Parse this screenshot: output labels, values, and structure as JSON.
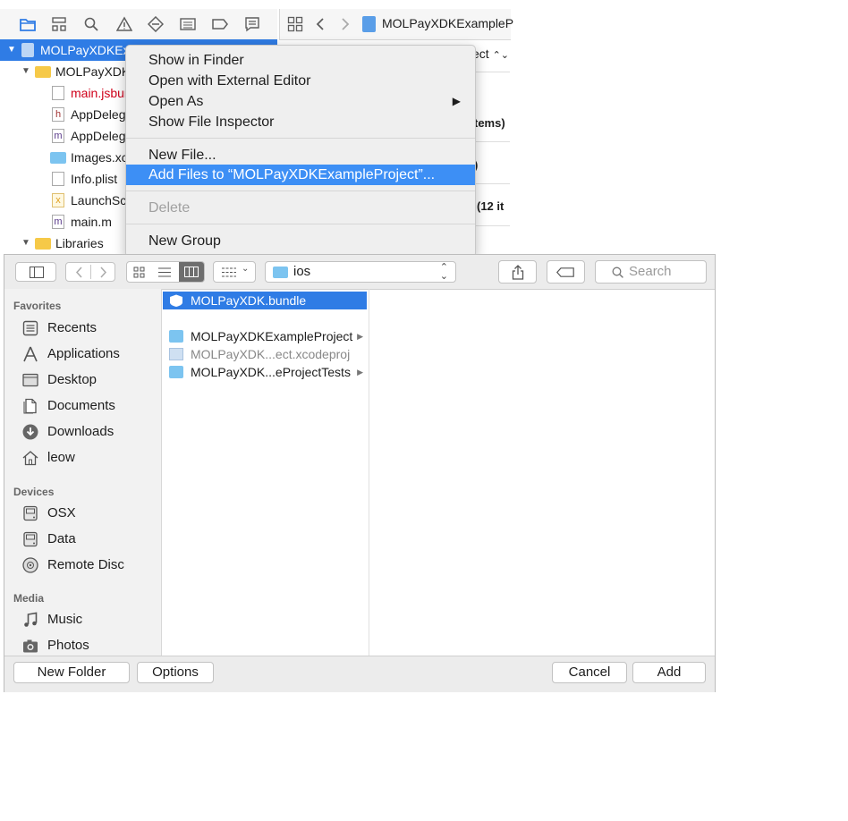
{
  "xcode": {
    "navigator": {
      "project_root": "MOLPayXDKEx",
      "group": "MOLPayXDK",
      "files": [
        {
          "name": "main.jsbun",
          "badge": "",
          "color": "#d0021b"
        },
        {
          "name": "AppDeleg",
          "badge": "h",
          "color": "#1d1d1d"
        },
        {
          "name": "AppDeleg",
          "badge": "m",
          "color": "#1d1d1d"
        },
        {
          "name": "Images.xc",
          "badge": "",
          "color": "#1d1d1d"
        },
        {
          "name": "Info.plist",
          "badge": "",
          "color": "#1d1d1d"
        },
        {
          "name": "LaunchSc",
          "badge": "x",
          "color": "#1d1d1d"
        },
        {
          "name": "main.m",
          "badge": "m",
          "color": "#1d1d1d"
        }
      ],
      "libraries": "Libraries"
    },
    "editor": {
      "breadcrumb": "MOLPayXDKExampleP",
      "popup_fragment": "ect",
      "fragments": [
        "tems)",
        ")",
        "(12 it"
      ]
    }
  },
  "context_menu": {
    "items": [
      {
        "label": "Show in Finder"
      },
      {
        "label": "Open with External Editor"
      },
      {
        "label": "Open As",
        "submenu": "▶"
      },
      {
        "label": "Show File Inspector"
      },
      {
        "label": "New File..."
      },
      {
        "label": "Add Files to “MOLPayXDKExampleProject”..."
      },
      {
        "label": "Delete"
      },
      {
        "label": "New Group"
      }
    ]
  },
  "open_dialog": {
    "path_popup": "ios",
    "search": {
      "placeholder": "Search"
    },
    "sidebar": {
      "favorites_label": "Favorites",
      "favorites": [
        {
          "label": "Recents",
          "icon": "recents-icon"
        },
        {
          "label": "Applications",
          "icon": "applications-icon"
        },
        {
          "label": "Desktop",
          "icon": "desktop-icon"
        },
        {
          "label": "Documents",
          "icon": "documents-icon"
        },
        {
          "label": "Downloads",
          "icon": "downloads-icon"
        },
        {
          "label": "leow",
          "icon": "home-icon"
        }
      ],
      "devices_label": "Devices",
      "devices": [
        {
          "label": "OSX",
          "icon": "disk-icon"
        },
        {
          "label": "Data",
          "icon": "disk-icon"
        },
        {
          "label": "Remote Disc",
          "icon": "remote-disc-icon"
        }
      ],
      "media_label": "Media",
      "media": [
        {
          "label": "Music",
          "icon": "music-icon"
        },
        {
          "label": "Photos",
          "icon": "photos-icon"
        }
      ]
    },
    "files": [
      {
        "name": "MOLPayXDK.bundle",
        "selected": true
      },
      {
        "name": "MOLPayXDKExampleProject",
        "folder": true,
        "arrow": "▶"
      },
      {
        "name": "MOLPayXDK...ect.xcodeproj",
        "dimmed": true
      },
      {
        "name": "MOLPayXDK...eProjectTests",
        "folder": true,
        "arrow": "▶"
      }
    ],
    "buttons": {
      "new_folder": "New Folder",
      "options": "Options",
      "cancel": "Cancel",
      "add": "Add"
    }
  },
  "colors": {
    "accent": "#3d8ff5",
    "selection": "#2f7ce5",
    "folder": "#7cc4f0"
  }
}
